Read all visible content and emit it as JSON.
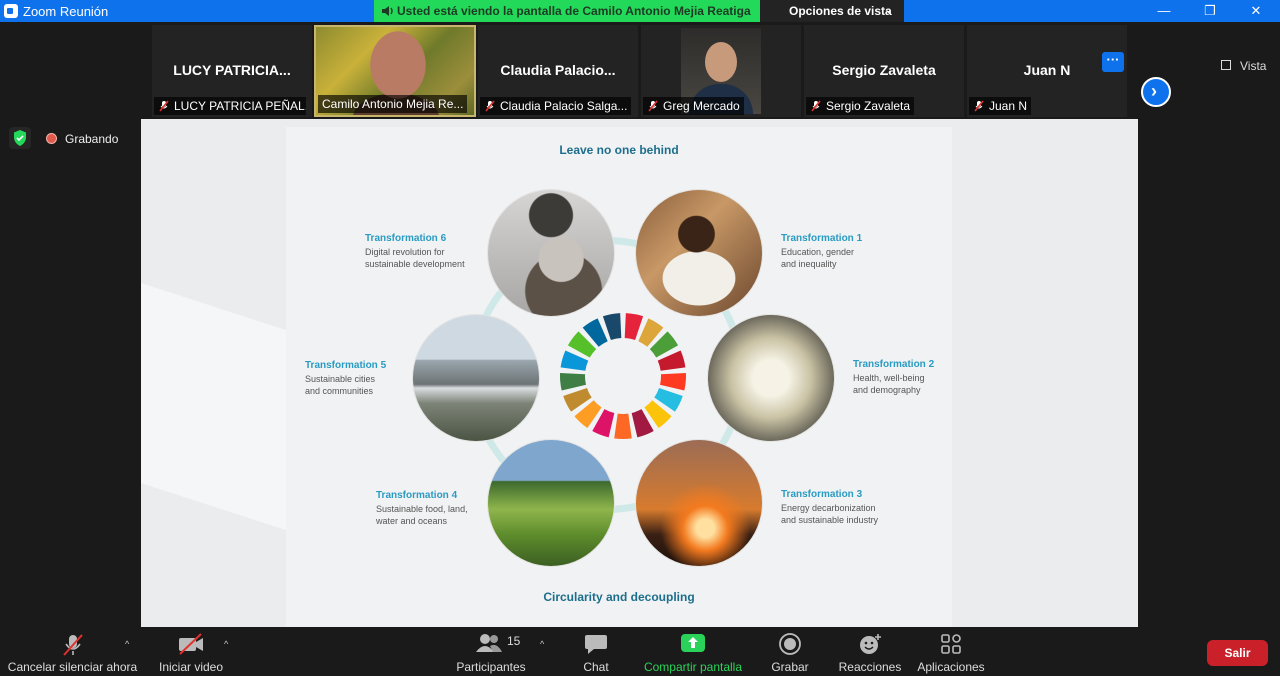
{
  "window": {
    "title": "Zoom Reunión",
    "minimize": "—",
    "restore": "❐",
    "close": "✕"
  },
  "share_banner": {
    "text": "Usted está viendo la pantalla de Camilo Antonio Mejia Reatiga"
  },
  "view_options": {
    "label": "Opciones de vista"
  },
  "participants": [
    {
      "display_name": "LUCY PATRICIA...",
      "label": "LUCY PATRICIA PEÑAL...",
      "muted": true,
      "video": false
    },
    {
      "display_name": "",
      "label": "Camilo Antonio Mejia Re...",
      "muted": false,
      "video": true,
      "active_speaker": true
    },
    {
      "display_name": "Claudia  Palacio...",
      "label": "Claudia Palacio Salga...",
      "muted": true,
      "video": false
    },
    {
      "display_name": "",
      "label": "Greg Mercado",
      "muted": true,
      "video": true
    },
    {
      "display_name": "Sergio Zavaleta",
      "label": "Sergio Zavaleta",
      "muted": true,
      "video": false
    },
    {
      "display_name": "Juan N",
      "label": "Juan N",
      "muted": true,
      "video": false
    }
  ],
  "strip_controls": {
    "more": "···",
    "next": "›",
    "view": "Vista"
  },
  "recording": {
    "label": "Grabando"
  },
  "slide": {
    "top_title": "Leave no one behind",
    "bottom_title": "Circularity and decoupling",
    "transformations": [
      {
        "title": "Transformation 1",
        "desc": "Education, gender\nand inequality"
      },
      {
        "title": "Transformation 2",
        "desc": "Health, well-being\nand demography"
      },
      {
        "title": "Transformation 3",
        "desc": "Energy decarbonization\nand sustainable industry"
      },
      {
        "title": "Transformation 4",
        "desc": "Sustainable food, land,\nwater and oceans"
      },
      {
        "title": "Transformation 5",
        "desc": "Sustainable cities\nand communities"
      },
      {
        "title": "Transformation 6",
        "desc": "Digital revolution for\nsustainable development"
      }
    ],
    "sdg_colors": [
      "#e5243b",
      "#dda63a",
      "#4c9f38",
      "#c5192d",
      "#ff3a21",
      "#26bde2",
      "#fcc30b",
      "#a21942",
      "#fd6925",
      "#dd1367",
      "#fd9d24",
      "#bf8b2e",
      "#3f7e44",
      "#0a97d9",
      "#56c02b",
      "#00689d",
      "#19486a"
    ]
  },
  "toolbar": {
    "mute_label": "Cancelar silenciar ahora",
    "video_label": "Iniciar video",
    "participants_label": "Participantes",
    "participants_count": "15",
    "chat_label": "Chat",
    "share_label": "Compartir pantalla",
    "record_label": "Grabar",
    "reactions_label": "Reacciones",
    "apps_label": "Aplicaciones",
    "leave_label": "Salir"
  }
}
